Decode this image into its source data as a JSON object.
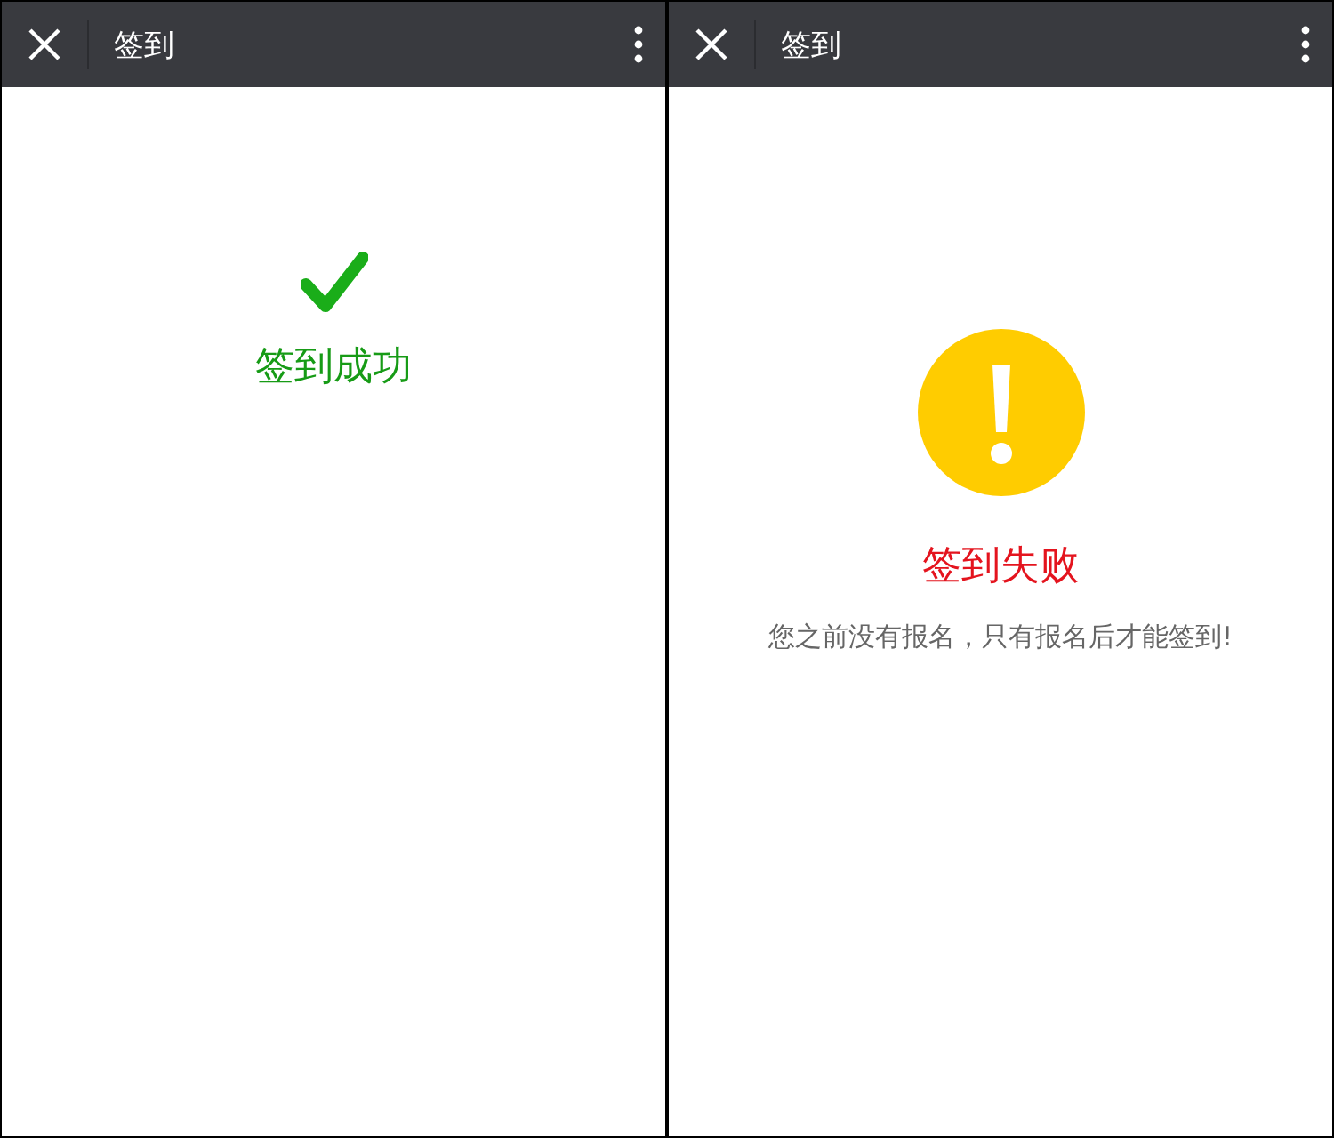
{
  "screens": [
    {
      "title": "签到",
      "kind": "success",
      "message": "签到成功"
    },
    {
      "title": "签到",
      "kind": "failure",
      "message": "签到失败",
      "detail": "您之前没有报名，只有报名后才能签到!"
    }
  ]
}
